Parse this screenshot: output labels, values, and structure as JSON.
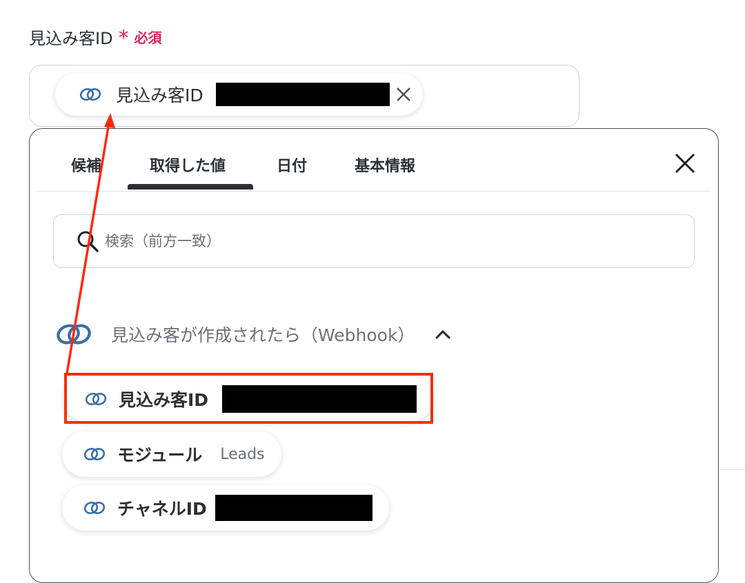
{
  "field": {
    "label": "見込み客ID",
    "required_mark": "*",
    "required_text": "必須"
  },
  "selected_token": {
    "label": "見込み客ID"
  },
  "popup": {
    "tabs": [
      {
        "label": "候補"
      },
      {
        "label": "取得した値",
        "active": true
      },
      {
        "label": "日付"
      },
      {
        "label": "基本情報"
      }
    ],
    "search": {
      "placeholder": "検索（前方一致）"
    },
    "group": {
      "title": "見込み客が作成されたら（Webhook）",
      "expanded": true
    },
    "items": [
      {
        "label": "見込み客ID",
        "value": ""
      },
      {
        "label": "モジュール",
        "value": "Leads"
      },
      {
        "label": "チャネルID",
        "value": ""
      }
    ]
  },
  "colors": {
    "required": "#e0245e",
    "annotation": "#ff2a0f",
    "link_icon": "#3a6ea5",
    "text": "#2b2f36",
    "muted": "#6b7078"
  },
  "icons": [
    "link-icon",
    "close-icon",
    "search-icon",
    "chevron-up-icon"
  ]
}
